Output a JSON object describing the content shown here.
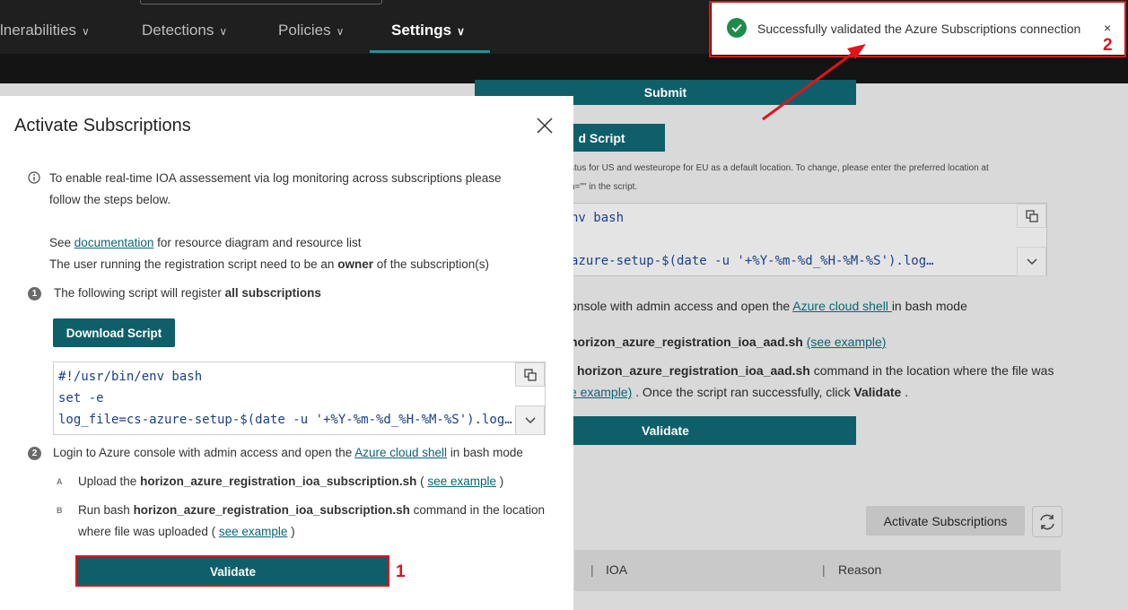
{
  "nav": {
    "items": [
      {
        "label": "lnerabilities"
      },
      {
        "label": "Detections"
      },
      {
        "label": "Policies"
      },
      {
        "label": "Settings"
      }
    ]
  },
  "background": {
    "submit_label": "Submit",
    "download_script_label": "d Script",
    "location_note_1": "stus for US and westeurope for EU as a default location. To change, please enter the preferred location at",
    "location_note_2": "n=\"\" in the script.",
    "code_line_1": "nv bash",
    "code_line_2": "azure-setup-$(date -u '+%Y-%m-%d_%H-%M-%S').log…",
    "console_text": "onsole with admin access and open the",
    "azure_shell_link": "Azure cloud shell ",
    "console_text_end": "in bash mode",
    "upload_file": "horizon_azure_registration_ioa_aad.sh",
    "see_example_1": "(see example)",
    "run_file": "horizon_azure_registration_ioa_aad.sh",
    "run_text": "command in the location where the file was",
    "see_example_2": "e example)",
    "after_run_text": ". Once the script ran successfully, click",
    "after_run_bold": "Validate",
    "after_run_end": ".",
    "validate_label": "Validate",
    "activate_subscriptions_label": "Activate Subscriptions",
    "table_headers": [
      "IOA",
      "Reason"
    ]
  },
  "modal": {
    "title": "Activate Subscriptions",
    "info_line_1": "To enable real-time IOA assessement via log monitoring across subscriptions please",
    "info_line_2": "follow the steps below.",
    "see_prefix": "See",
    "documentation_link": "documentation",
    "see_suffix": "for resource diagram and resource list",
    "owner_prefix": "The user running the registration script need to be an",
    "owner_bold": "owner",
    "owner_suffix": "of the subscription(s)",
    "step1_number": "1",
    "step1_text": "The following script will register",
    "step1_bold": "all subscriptions",
    "download_script_label": "Download Script",
    "code_lines": [
      "#!/usr/bin/env bash",
      "set -e",
      "log_file=cs-azure-setup-$(date -u '+%Y-%m-%d_%H-%M-%S').log…"
    ],
    "step2_number": "2",
    "step2_text": "Login to Azure console with admin access and open the",
    "azure_shell_link": "Azure cloud shell",
    "step2_suffix": "in bash mode",
    "sub_a_letter": "A",
    "sub_a_prefix": "Upload the",
    "sub_a_file": "horizon_azure_registration_ioa_subscription.sh",
    "sub_a_open": "(",
    "sub_a_link": "see example",
    "sub_a_close": ")",
    "sub_b_letter": "B",
    "sub_b_prefix": "Run bash",
    "sub_b_file": "horizon_azure_registration_ioa_subscription.sh",
    "sub_b_suffix": "command in the location",
    "sub_b_line2": "where file was uploaded (",
    "sub_b_link": "see example",
    "sub_b_close": ")",
    "validate_label": "Validate"
  },
  "toast": {
    "message": "Successfully validated the Azure Subscriptions connection",
    "close": "×"
  },
  "annotations": {
    "label_1": "1",
    "label_2": "2",
    "color": "#e0141a"
  },
  "colors": {
    "primary": "#0e5f6a",
    "success": "#1f8a4c",
    "topbar": "#1f1f1f"
  }
}
